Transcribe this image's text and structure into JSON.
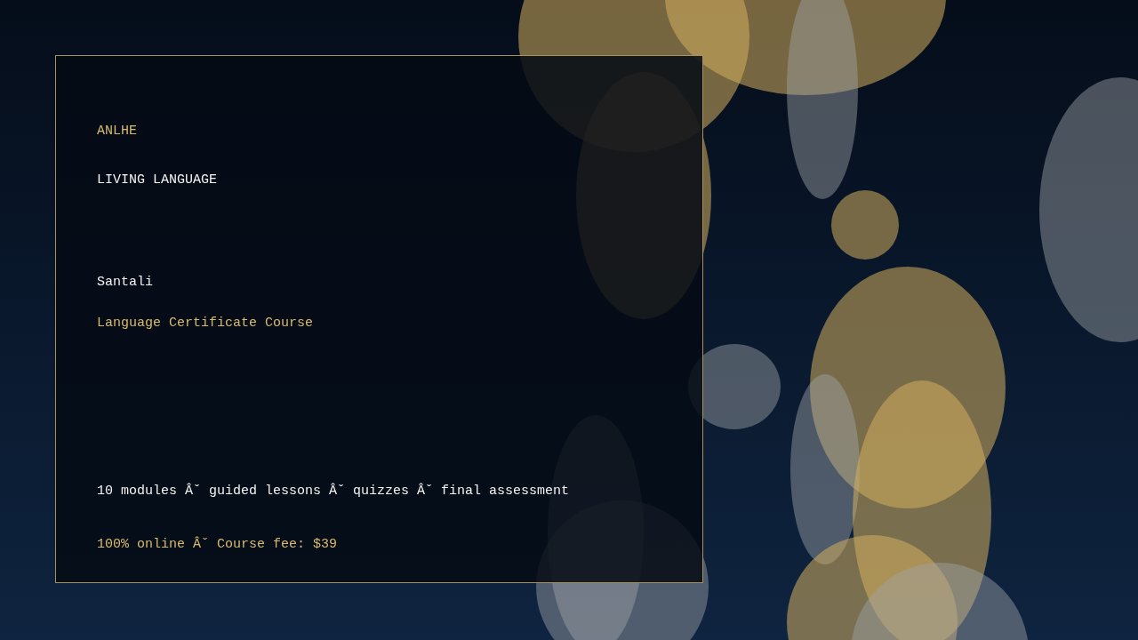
{
  "brand": "ANLHE",
  "tagline": "LIVING LANGUAGE",
  "course": {
    "language": "Santali",
    "title": "Language Certificate Course"
  },
  "details": {
    "features": "10 modules Âˇ guided lessons Âˇ quizzes Âˇ final assessment",
    "pricing": "100% online Âˇ Course fee: $39"
  }
}
